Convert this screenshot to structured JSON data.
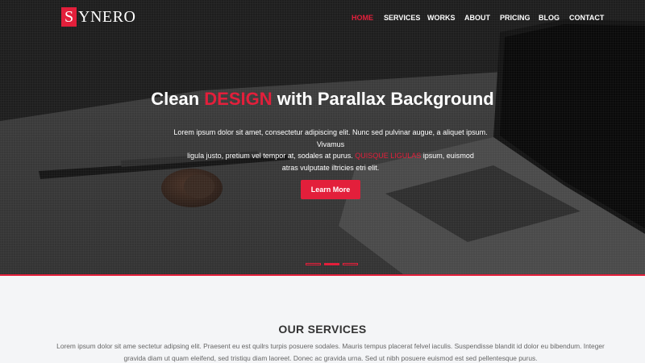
{
  "brand": {
    "initial": "S",
    "rest": "YNERO",
    "accent_color": "#e31f3b"
  },
  "nav": {
    "items": [
      {
        "label": "HOME",
        "active": true
      },
      {
        "label": "SERVICES",
        "active": false
      },
      {
        "label": "WORKS",
        "active": false
      },
      {
        "label": "ABOUT",
        "active": false
      },
      {
        "label": "PRICING",
        "active": false
      },
      {
        "label": "BLOG",
        "active": false
      },
      {
        "label": "CONTACT",
        "active": false
      }
    ]
  },
  "hero": {
    "title_pre": "Clean ",
    "title_accent": "DESIGN",
    "title_post": " with Parallax Background",
    "desc_line1": "Lorem ipsum dolor sit amet, consectetur adipiscing elit. Nunc sed pulvinar augue, a aliquet ipsum. Vivamus",
    "desc_line2_pre": "ligula justo, pretium vel tempor at, sodales at purus. ",
    "desc_line2_accent": "QUISQUE LIGULAS",
    "desc_line2_post": " ipsum, euismod",
    "desc_line3": "atras vulputate iltricies etri elit.",
    "button_label": "Learn More",
    "slides": [
      false,
      true,
      false
    ]
  },
  "services": {
    "title": "OUR SERVICES",
    "desc_line1": "Lorem ipsum dolor sit ame sectetur adipsing elit. Praesent eu est quilrs turpis posuere sodales. Mauris tempus placerat felvel iaculis. Suspendisse blandit id dolor eu bibendum. Integer",
    "desc_line2": "gravida diam ut quam eleifend, sed tristiqu diam laoreet. Donec ac gravida urna. Sed ut nibh posuere euismod est sed pellentesque purus."
  }
}
